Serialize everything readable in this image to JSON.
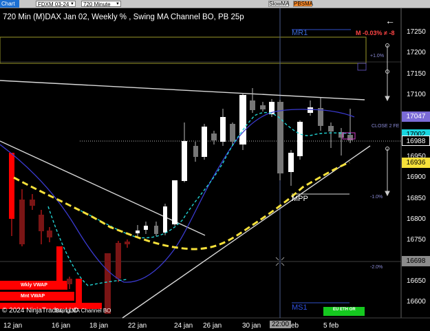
{
  "toolbar": {
    "chart_tab": "Chart",
    "instrument": "FDXM 03-24",
    "interval": "720 Minute",
    "btn1": "SlowMA",
    "btn2": "PBSMA"
  },
  "title": "720 Min (M)DAX Jan 02, Weekly % , Swing MA Channel BO, PB 25p",
  "top_right_stat": "M -0.03% ≠ -8",
  "levels": {
    "mr1": "MR1",
    "ms1": "MS1",
    "mpp": "MPP",
    "plus1": "+1.0%",
    "minus1": "-1.0%",
    "minus2": "-2.0%",
    "close2": "CLOSE 2 FE",
    "wkly_vwap": "Wkly VWAP",
    "mnt_vwap": "Mnt VWAP",
    "eu_eth": "EU ETH OR"
  },
  "price_labels": [
    {
      "text": "17047",
      "bg": "#7b6bd6",
      "fg": "#ffffff"
    },
    {
      "text": "17002",
      "bg": "#19d6e0",
      "fg": "#000000"
    },
    {
      "text": "16988",
      "bg": "#000000",
      "fg": "#ffffff"
    },
    {
      "text": "16936",
      "bg": "#f5e03a",
      "fg": "#000000"
    },
    {
      "text": "16698",
      "bg": "#8b8b8b",
      "fg": "#000000"
    }
  ],
  "y_axis": [
    "17250",
    "17200",
    "17150",
    "17100",
    "17050",
    "17000",
    "16950",
    "16900",
    "16850",
    "16800",
    "16750",
    "16700",
    "16650",
    "16600"
  ],
  "x_axis": [
    "12 jan",
    "16 jan",
    "18 jan",
    "22 jan",
    "24 jan",
    "26 jan",
    "30 jan",
    "22:00",
    "5 feb"
  ],
  "crosshair_time": "22:00",
  "footer": "© 2024 NinjaTrader, LLC",
  "watermark": "Swing MA Channel BO",
  "colors": {
    "bull": "#ffffff",
    "bear": "#6b6b6b",
    "red": "#ff0000",
    "slow_ma": "#3a3acf",
    "fast_ma": "#22d3d3",
    "yellow": "#f5e03a",
    "trend": "#e6e6e6"
  }
}
